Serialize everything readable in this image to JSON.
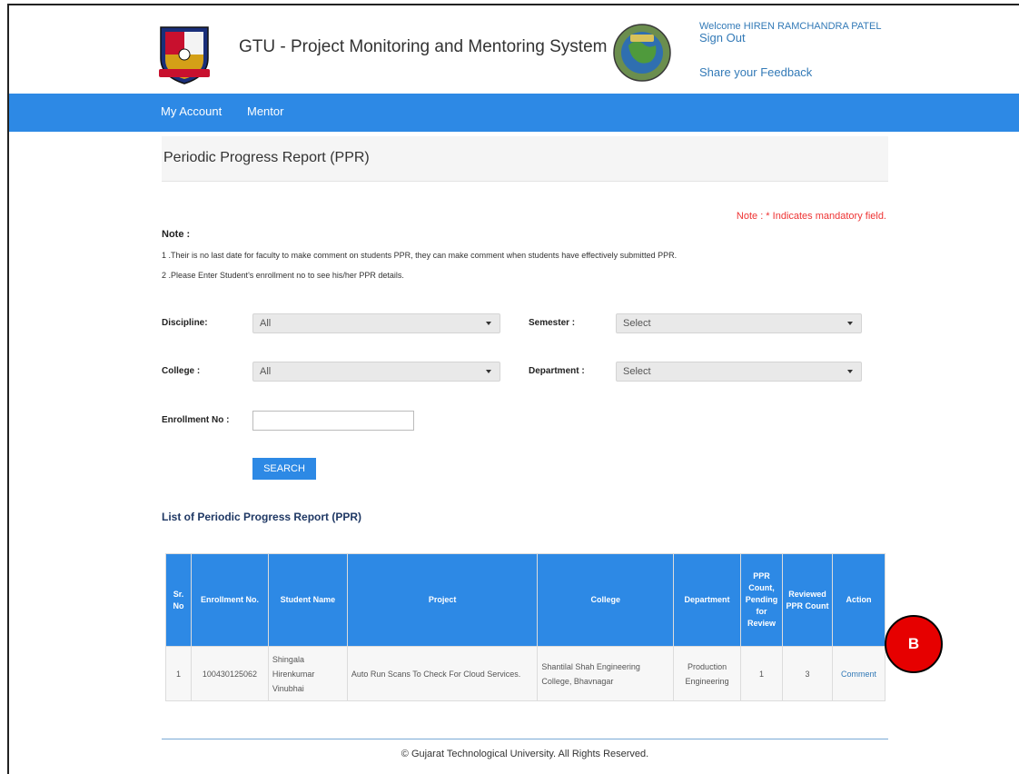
{
  "header": {
    "app_title": "GTU - Project Monitoring and Mentoring System",
    "welcome": "Welcome HIREN RAMCHANDRA PATEL",
    "sign_out": "Sign Out",
    "feedback": "Share your Feedback"
  },
  "nav": {
    "items": [
      "My Account",
      "Mentor"
    ]
  },
  "page": {
    "title": "Periodic Progress Report (PPR)",
    "mandatory_note": "Note : * Indicates mandatory field.",
    "note_title": "Note :",
    "notes": [
      "1 .Their is no last date for faculty to make comment on students PPR, they can make comment when students have effectively submitted PPR.",
      "2 .Please Enter Student's enrollment no to see his/her PPR details."
    ]
  },
  "form": {
    "discipline_label": "Discipline:",
    "discipline_value": "All",
    "semester_label": "Semester :",
    "semester_value": "Select",
    "college_label": "College :",
    "college_value": "All",
    "department_label": "Department :",
    "department_value": "Select",
    "enrollment_label": "Enrollment No :",
    "enrollment_value": "",
    "search_label": "SEARCH"
  },
  "list": {
    "title": "List of Periodic Progress Report (PPR)",
    "headers": [
      "Sr. No",
      "Enrollment No.",
      "Student Name",
      "Project",
      "College",
      "Department",
      "PPR Count, Pending for Review",
      "Reviewed PPR Count",
      "Action"
    ],
    "rows": [
      [
        "1",
        "100430125062",
        "Shingala Hirenkumar Vinubhai",
        "Auto Run Scans To Check For Cloud Services.",
        "Shantilal Shah Engineering College, Bhavnagar",
        "Production Engineering",
        "1",
        "3",
        "Comment"
      ]
    ]
  },
  "annotation": {
    "badge": "B",
    "color": "#e60000"
  },
  "footer": {
    "text": "© Gujarat Technological University. All Rights Reserved."
  },
  "colors": {
    "nav": "#2d89e5",
    "link": "#337ab7",
    "mandatory": "#e33"
  }
}
